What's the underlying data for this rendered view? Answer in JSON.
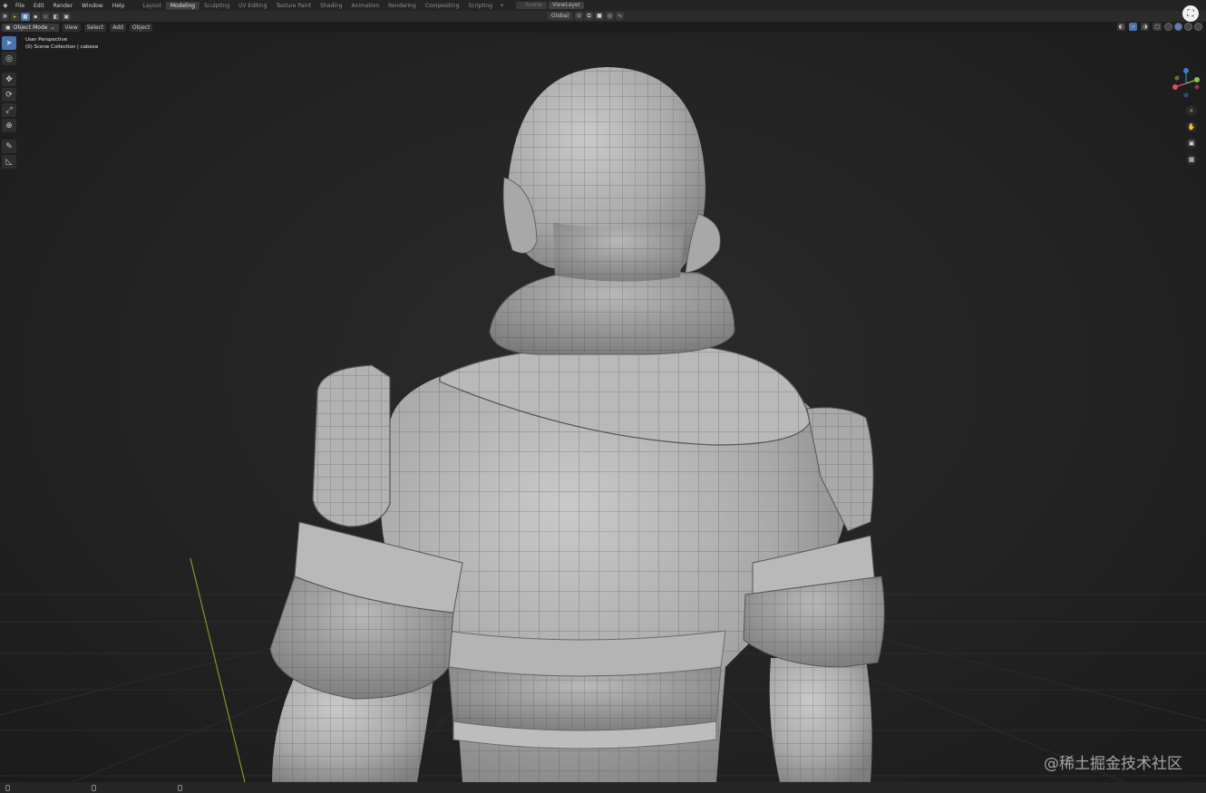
{
  "menubar": {
    "logo_icon": "blender-logo-icon",
    "menus": [
      "File",
      "Edit",
      "Render",
      "Window",
      "Help"
    ],
    "workspace_tabs": [
      "Layout",
      "Modeling",
      "Sculpting",
      "UV Editing",
      "Texture Paint",
      "Shading",
      "Animation",
      "Rendering",
      "Compositing",
      "Scripting"
    ],
    "active_tab": "Modeling",
    "add_tab": "+",
    "scene_field": "Scene",
    "view_layer_field": "ViewLayer"
  },
  "toolbar": {
    "orientation": "Global"
  },
  "viewport_header": {
    "mode": "Object Mode",
    "menus": [
      "View",
      "Select",
      "Add",
      "Object"
    ]
  },
  "viewport": {
    "view_name": "User Perspective",
    "collection_info": "(0) Scene Collection | cabeza"
  },
  "tools": [
    "select-box-icon",
    "cursor-icon",
    "move-icon",
    "rotate-icon",
    "scale-icon",
    "transform-icon",
    "annotate-icon",
    "measure-icon"
  ],
  "gizmo": {
    "x_color": "#e84a5f",
    "y_color": "#8bc34a",
    "z_color": "#3b82c4"
  },
  "watermark": "@稀土掘金技术社区",
  "colors": {
    "accent": "#4772b3",
    "background": "#232323"
  }
}
